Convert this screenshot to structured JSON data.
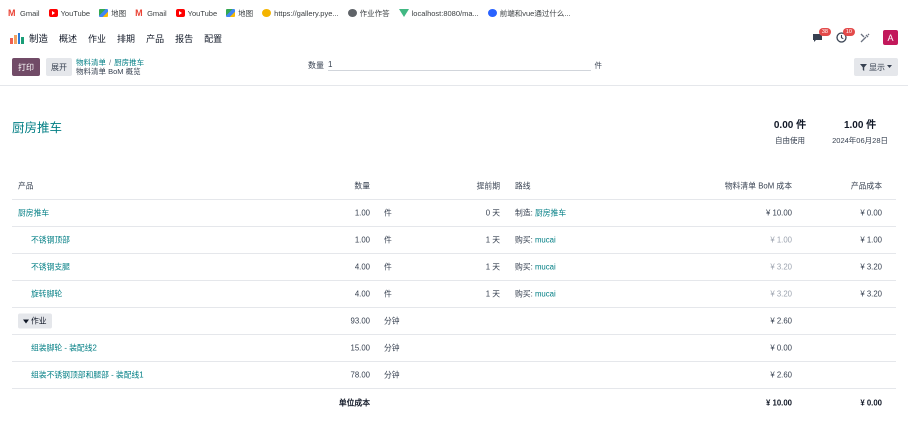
{
  "bookmarks": [
    {
      "label": "Gmail",
      "icon": "gmail-icon",
      "type": "gmail"
    },
    {
      "label": "YouTube",
      "icon": "youtube-icon",
      "type": "yt"
    },
    {
      "label": "地图",
      "icon": "maps-icon",
      "type": "map"
    },
    {
      "label": "Gmail",
      "icon": "gmail-icon",
      "type": "gmail"
    },
    {
      "label": "YouTube",
      "icon": "youtube-icon",
      "type": "yt"
    },
    {
      "label": "地图",
      "icon": "maps-icon",
      "type": "map"
    },
    {
      "label": "https://gallery.pye...",
      "icon": "gallery-icon",
      "type": "gallery"
    },
    {
      "label": "作业作答",
      "icon": "globe-icon",
      "type": "globe"
    },
    {
      "label": "localhost:8080/ma...",
      "icon": "vue-icon",
      "type": "vue"
    },
    {
      "label": "前端和vue通过什么...",
      "icon": "alibaba-icon",
      "type": "ali"
    }
  ],
  "navbar": {
    "app_name": "制造",
    "menu": [
      "概述",
      "作业",
      "排期",
      "产品",
      "报告",
      "配置"
    ],
    "chat_badge": "38",
    "activity_badge": "10",
    "avatar": "A"
  },
  "control": {
    "print_label": "打印",
    "expand_label": "展开",
    "breadcrumb_1": "物料清单",
    "breadcrumb_sep": "/",
    "breadcrumb_2": "厨房推车",
    "breadcrumb_current": "物料清单 BoM 概览",
    "qty_label": "数量",
    "qty_value": "1",
    "qty_unit": "件",
    "display_label": "显示"
  },
  "report": {
    "product_title": "厨房推车",
    "free_qty_value": "0.00 件",
    "free_qty_label": "自由使用",
    "forecast_value": "1.00 件",
    "forecast_label": "2024年06月28日"
  },
  "table": {
    "headers": {
      "product": "产品",
      "quantity": "数量",
      "lead_time": "提前期",
      "route": "路线",
      "bom_cost": "物料清单 BoM 成本",
      "product_cost": "产品成本"
    },
    "rows": [
      {
        "product": "厨房推车",
        "qty": "1.00",
        "uom": "件",
        "lead": "0 天",
        "route_prefix": "制造:",
        "route_link": "厨房推车",
        "bom_cost": "¥ 10.00",
        "product_cost": "¥ 0.00",
        "level": 0,
        "muted_bom": false
      },
      {
        "product": "不锈钢顶部",
        "qty": "1.00",
        "uom": "件",
        "lead": "1 天",
        "route_prefix": "购买:",
        "route_link": "mucai",
        "bom_cost": "¥ 1.00",
        "product_cost": "¥ 1.00",
        "level": 1,
        "muted_bom": true
      },
      {
        "product": "不锈钢支腿",
        "qty": "4.00",
        "uom": "件",
        "lead": "1 天",
        "route_prefix": "购买:",
        "route_link": "mucai",
        "bom_cost": "¥ 3.20",
        "product_cost": "¥ 3.20",
        "level": 1,
        "muted_bom": true
      },
      {
        "product": "旋转脚轮",
        "qty": "4.00",
        "uom": "件",
        "lead": "1 天",
        "route_prefix": "购买:",
        "route_link": "mucai",
        "bom_cost": "¥ 3.20",
        "product_cost": "¥ 3.20",
        "level": 1,
        "muted_bom": true
      }
    ],
    "operations": {
      "label": "作业",
      "qty": "93.00",
      "uom": "分钟",
      "bom_cost": "¥ 2.60",
      "items": [
        {
          "name": "组装脚轮 - 装配线2",
          "qty": "15.00",
          "uom": "分钟",
          "bom_cost": "¥ 0.00"
        },
        {
          "name": "组装不锈钢顶部和腿部 - 装配线1",
          "qty": "78.00",
          "uom": "分钟",
          "bom_cost": "¥ 2.60"
        }
      ]
    },
    "footer": {
      "label": "单位成本",
      "bom_cost": "¥ 10.00",
      "product_cost": "¥ 0.00"
    }
  },
  "colors": {
    "primary": "#714b67",
    "link": "#017e84",
    "badge": "#e34a4a",
    "avatar": "#c2185b"
  }
}
